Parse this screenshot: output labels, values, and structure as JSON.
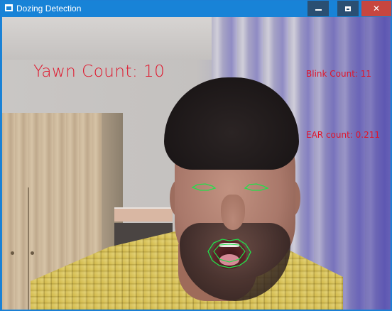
{
  "window": {
    "title": "Dozing Detection",
    "controls": {
      "minimize": "minimize",
      "maximize": "maximize",
      "close": "✕"
    }
  },
  "overlay": {
    "yawn_count": "Yawn Count: 10",
    "blink_count": "Blink Count: 11",
    "ear_count": "EAR count: 0.211",
    "text_color": "#e0152b",
    "contour_color": "#22e04a"
  },
  "icons": {
    "app": "window-app-icon",
    "minimize": "minimize-icon",
    "maximize": "maximize-icon",
    "close": "close-icon"
  },
  "colors": {
    "titlebar": "#1883d7",
    "close_button": "#c7463f"
  }
}
